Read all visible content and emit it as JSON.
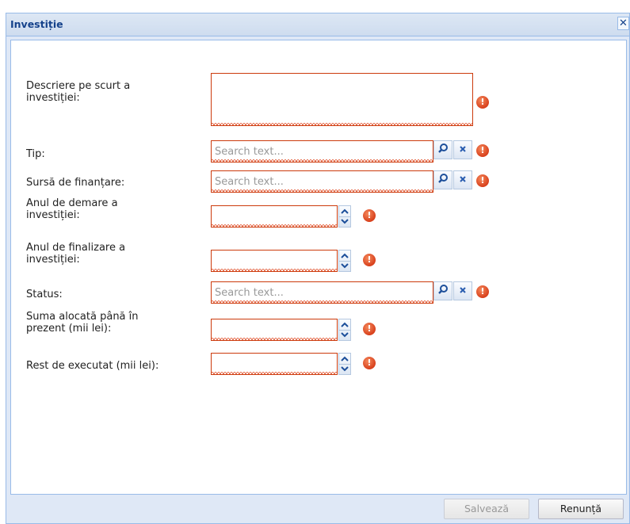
{
  "window": {
    "title": "Investiție",
    "close_label": "✕"
  },
  "fields": [
    {
      "label": "Descriere pe scurt a\ninvestiției:",
      "type": "textarea",
      "value": "",
      "placeholder": ""
    },
    {
      "label": "Tip:",
      "type": "lookup",
      "value": "",
      "placeholder": "Search text..."
    },
    {
      "label": "Sursă de finanțare:",
      "type": "lookup",
      "value": "",
      "placeholder": "Search text..."
    },
    {
      "label": "Anul de demare a\ninvestiției:",
      "type": "number",
      "value": "",
      "placeholder": ""
    },
    {
      "label": "Anul de finalizare a\ninvestiției:",
      "type": "number",
      "value": "",
      "placeholder": ""
    },
    {
      "label": "Status:",
      "type": "lookup",
      "value": "",
      "placeholder": "Search text..."
    },
    {
      "label": "Suma alocată până în\nprezent (mii lei):",
      "type": "number",
      "value": "",
      "placeholder": ""
    },
    {
      "label": "Rest de executat (mii lei):",
      "type": "number",
      "value": "",
      "placeholder": ""
    }
  ],
  "icons": {
    "search": "search-icon",
    "clear": "clear-icon",
    "error": "error-icon",
    "spin_up": "chevron-up-icon",
    "spin_down": "chevron-down-icon"
  },
  "error_glyph": "!",
  "buttons": {
    "save_label": "Salvează",
    "cancel_label": "Renunță"
  },
  "colors": {
    "title": "#15428b",
    "invalid_border": "#cc3a0c",
    "error_icon": "#d8401c",
    "panel_bg": "#dfe8f6"
  }
}
